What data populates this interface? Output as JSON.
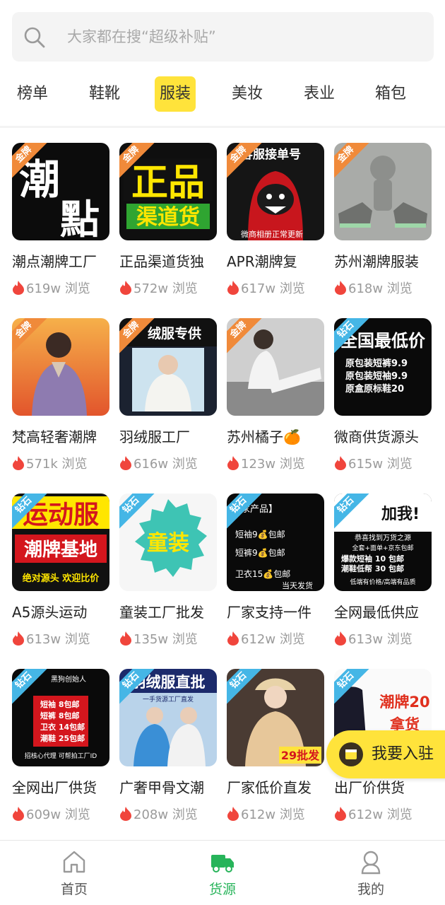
{
  "search": {
    "placeholder": "大家都在搜“超级补贴”"
  },
  "tabs": [
    {
      "label": "榜单",
      "active": false
    },
    {
      "label": "鞋靴",
      "active": false
    },
    {
      "label": "服装",
      "active": true
    },
    {
      "label": "美妆",
      "active": false
    },
    {
      "label": "表业",
      "active": false
    },
    {
      "label": "箱包",
      "active": false
    }
  ],
  "colors": {
    "accent": "#ffe33b",
    "nav_active": "#27b45a",
    "gold_ribbon": "#f08a3a",
    "diamond_ribbon": "#45b6e6",
    "flame": "#f0453c"
  },
  "badges": {
    "gold": "金牌",
    "diamond": "钻石"
  },
  "view_suffix": "浏览",
  "cards": [
    {
      "name": "潮点潮牌工厂",
      "views": "619w",
      "badge": "gold",
      "thumb_text": [
        "潮",
        "點"
      ]
    },
    {
      "name": "正品渠道货独",
      "views": "572w",
      "badge": "gold",
      "thumb_text": [
        "正品",
        "渠道货"
      ]
    },
    {
      "name": "APR潮牌复",
      "views": "617w",
      "badge": "gold",
      "thumb_text": [
        "客服接单号",
        "微商相册正常更新"
      ]
    },
    {
      "name": "苏州潮牌服装",
      "views": "618w",
      "badge": "gold",
      "thumb_text": []
    },
    {
      "name": "梵高轻奢潮牌",
      "views": "571k",
      "badge": "gold",
      "thumb_text": []
    },
    {
      "name": "羽绒服工厂",
      "views": "616w",
      "badge": "gold",
      "thumb_text": [
        "绒服专供"
      ]
    },
    {
      "name": "苏州橘子🍊",
      "views": "123w",
      "badge": "gold",
      "thumb_text": []
    },
    {
      "name": "微商供货源头",
      "views": "615w",
      "badge": "diamond",
      "thumb_text": [
        "全国最低价",
        "原包装短裤9.9",
        "原包装短袖9.9",
        "原盒原标鞋20"
      ]
    },
    {
      "name": "A5源头运动",
      "views": "613w",
      "badge": "diamond",
      "thumb_text": [
        "运动服",
        "潮牌基地",
        "绝对源头 欢迎比价"
      ]
    },
    {
      "name": "童装工厂批发",
      "views": "135w",
      "badge": "diamond",
      "thumb_text": [
        "童装"
      ]
    },
    {
      "name": "厂家支持一件",
      "views": "612w",
      "badge": "diamond",
      "thumb_text": [
        "家产品】",
        "短袖9💰包邮",
        "短裤9💰包邮",
        "卫衣15💰包邮",
        "当天发货"
      ]
    },
    {
      "name": "全网最低供应",
      "views": "613w",
      "badge": "diamond",
      "thumb_text": [
        "加我!",
        "恭喜找到万货之源",
        "全套+面单+京东包邮",
        "爆款短袖 10 包邮",
        "潮鞋低帮 30 包邮",
        "低端有价格/高端有品质"
      ]
    },
    {
      "name": "全网出厂供货",
      "views": "609w",
      "badge": "diamond",
      "thumb_text": [
        "黑狗创始人",
        "短袖 8包邮",
        "短裤 8包邮",
        "卫衣 14包邮",
        "潮鞋 25包邮",
        "招核心代理 可帮拍工厂ID"
      ]
    },
    {
      "name": "广奢甲骨文潮",
      "views": "208w",
      "badge": "diamond",
      "thumb_text": [
        "羽绒服直批",
        "一手货源工厂直发"
      ]
    },
    {
      "name": "厂家低价直发",
      "views": "612w",
      "badge": "diamond",
      "thumb_text": [
        "29批发"
      ]
    },
    {
      "name": "出厂价供货",
      "views": "612w",
      "badge": "diamond",
      "thumb_text": [
        "潮牌20",
        "拿货"
      ]
    }
  ],
  "join_button": {
    "label": "我要入驻"
  },
  "bottom_nav": [
    {
      "label": "首页",
      "icon": "home-icon",
      "active": false
    },
    {
      "label": "货源",
      "icon": "truck-icon",
      "active": true
    },
    {
      "label": "我的",
      "icon": "user-icon",
      "active": false
    }
  ]
}
